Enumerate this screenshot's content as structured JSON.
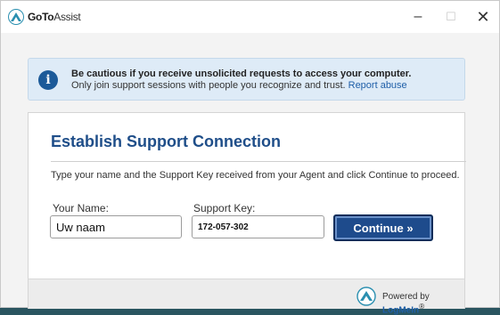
{
  "titlebar": {
    "brand_bold": "GoTo",
    "brand_rest": "Assist",
    "minimize_glyph": "–",
    "maximize_glyph": "☐",
    "close_glyph": "✕"
  },
  "alert": {
    "icon_glyph": "i",
    "line1": "Be cautious if you receive unsolicited requests to access your computer.",
    "line2": "Only join support sessions with people you recognize and trust.",
    "link": "Report abuse"
  },
  "panel": {
    "title": "Establish Support Connection",
    "instructions": "Type your name and the Support Key received from your Agent and click Continue to proceed.",
    "name_label": "Your Name:",
    "name_value": "Uw naam",
    "key_label": "Support Key:",
    "key_value": "172-057-302",
    "continue_label": "Continue »"
  },
  "footer": {
    "powered_by": "Powered by",
    "brand": "LogMeIn",
    "reg": "®"
  },
  "colors": {
    "accent": "#1f4e89",
    "button": "#1e4b8c",
    "alert_bg": "#deebf7",
    "link": "#1f5fa8"
  },
  "icons": [
    "gotoassist-logo-icon",
    "info-icon",
    "logmein-logo-icon",
    "minimize-icon",
    "maximize-icon",
    "close-icon"
  ]
}
